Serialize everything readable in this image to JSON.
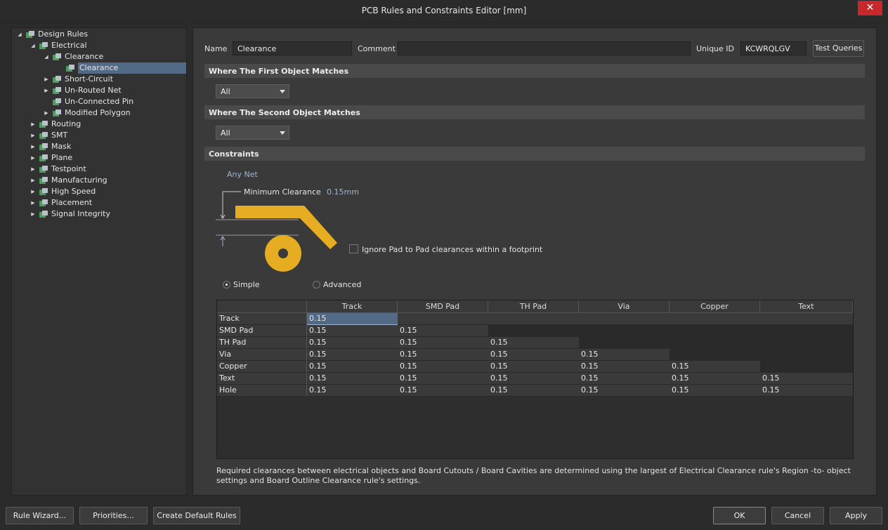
{
  "window": {
    "title": "PCB Rules and Constraints Editor [mm]",
    "close_glyph": "✕"
  },
  "tree": [
    {
      "label": "Design Rules",
      "expanded": true,
      "icon": "design-rules-icon"
    },
    {
      "label": "Electrical",
      "expanded": true,
      "icon": "rule-icon"
    },
    {
      "label": "Clearance",
      "expanded": true,
      "icon": "rule-icon"
    },
    {
      "label": "Clearance",
      "icon": "rule-icon",
      "selected": true
    },
    {
      "label": "Short-Circuit",
      "expanded": false,
      "icon": "rule-icon"
    },
    {
      "label": "Un-Routed Net",
      "expanded": false,
      "icon": "rule-icon"
    },
    {
      "label": "Un-Connected Pin",
      "icon": "rule-icon"
    },
    {
      "label": "Modified Polygon",
      "expanded": false,
      "icon": "rule-icon"
    },
    {
      "label": "Routing",
      "expanded": false,
      "icon": "routing-icon"
    },
    {
      "label": "SMT",
      "expanded": false,
      "icon": "smt-icon"
    },
    {
      "label": "Mask",
      "expanded": false,
      "icon": "mask-icon"
    },
    {
      "label": "Plane",
      "expanded": false,
      "icon": "plane-icon"
    },
    {
      "label": "Testpoint",
      "expanded": false,
      "icon": "testpoint-icon"
    },
    {
      "label": "Manufacturing",
      "expanded": false,
      "icon": "manufacturing-icon"
    },
    {
      "label": "High Speed",
      "expanded": false,
      "icon": "high-speed-icon"
    },
    {
      "label": "Placement",
      "expanded": false,
      "icon": "placement-icon"
    },
    {
      "label": "Signal Integrity",
      "expanded": false,
      "icon": "signal-integrity-icon"
    }
  ],
  "header": {
    "name_label": "Name",
    "name_value": "Clearance",
    "comment_label": "Comment",
    "comment_value": "",
    "uid_label": "Unique ID",
    "uid_value": "KCWRQLGV",
    "test_queries": "Test Queries"
  },
  "first_match": {
    "title": "Where The First Object Matches",
    "value": "All"
  },
  "second_match": {
    "title": "Where The Second Object Matches",
    "value": "All"
  },
  "constraints": {
    "title": "Constraints",
    "net_label": "Any Net",
    "min_clearance_label": "Minimum Clearance",
    "min_clearance_value": "0.15mm",
    "ignore_pad_label": "Ignore Pad to Pad clearances within a footprint",
    "simple_label": "Simple",
    "advanced_label": "Advanced",
    "mode": "simple"
  },
  "grid": {
    "columns": [
      "Track",
      "SMD Pad",
      "TH Pad",
      "Via",
      "Copper",
      "Text"
    ],
    "rows": [
      {
        "label": "Track",
        "values": [
          "0.15"
        ]
      },
      {
        "label": "SMD Pad",
        "values": [
          "0.15",
          "0.15"
        ]
      },
      {
        "label": "TH Pad",
        "values": [
          "0.15",
          "0.15",
          "0.15"
        ]
      },
      {
        "label": "Via",
        "values": [
          "0.15",
          "0.15",
          "0.15",
          "0.15"
        ]
      },
      {
        "label": "Copper",
        "values": [
          "0.15",
          "0.15",
          "0.15",
          "0.15",
          "0.15"
        ]
      },
      {
        "label": "Text",
        "values": [
          "0.15",
          "0.15",
          "0.15",
          "0.15",
          "0.15",
          "0.15"
        ]
      },
      {
        "label": "Hole",
        "values": [
          "0.15",
          "0.15",
          "0.15",
          "0.15",
          "0.15",
          "0.15"
        ]
      }
    ]
  },
  "note": "Required clearances between electrical objects and Board Cutouts / Board Cavities are determined using the largest of Electrical Clearance rule's Region -to- object settings and Board Outline Clearance rule's settings.",
  "footer": {
    "rule_wizard": "Rule Wizard...",
    "priorities": "Priorities...",
    "create_default": "Create Default Rules",
    "ok": "OK",
    "cancel": "Cancel",
    "apply": "Apply"
  },
  "colors": {
    "accent_selection": "#536a87",
    "copper": "#e6ad23",
    "close": "#c7282b"
  }
}
